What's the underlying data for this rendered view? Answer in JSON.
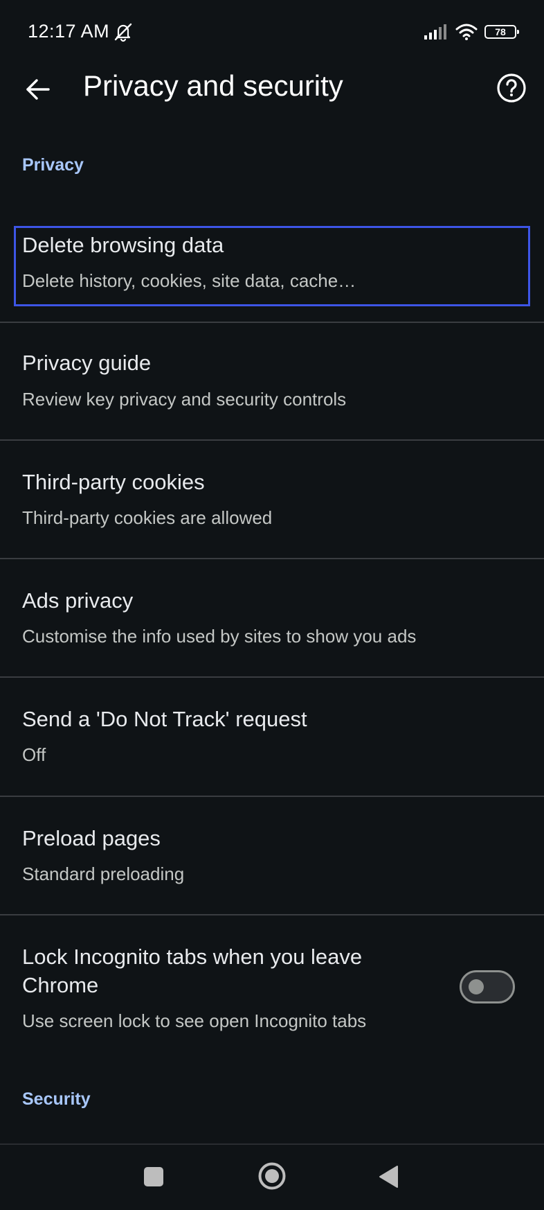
{
  "status_bar": {
    "time": "12:17 AM",
    "battery_level": "78",
    "icons": [
      "mute-icon",
      "signal-icon",
      "wifi-icon",
      "battery-icon"
    ]
  },
  "app_bar": {
    "title": "Privacy and security",
    "back_icon": "arrow-back-icon",
    "help_icon": "help-circle-icon"
  },
  "sections": {
    "privacy_header": "Privacy",
    "security_header": "Security"
  },
  "settings": [
    {
      "title": "Delete browsing data",
      "subtitle": "Delete history, cookies, site data, cache…"
    },
    {
      "title": "Privacy guide",
      "subtitle": "Review key privacy and security controls"
    },
    {
      "title": "Third-party cookies",
      "subtitle": "Third-party cookies are allowed"
    },
    {
      "title": "Ads privacy",
      "subtitle": "Customise the info used by sites to show you ads"
    },
    {
      "title": "Send a 'Do Not Track' request",
      "subtitle": "Off"
    },
    {
      "title": "Preload pages",
      "subtitle": "Standard preloading"
    },
    {
      "title_line1": "Lock Incognito tabs when you leave",
      "title_line2": "Chrome",
      "subtitle": "Use screen lock to see open Incognito tabs",
      "toggle_on": false
    }
  ],
  "nav_bar": {
    "icons": [
      "recents-square-icon",
      "home-circle-icon",
      "back-triangle-icon"
    ]
  },
  "colors": {
    "background": "#0f1316",
    "section_header": "#a8c7fa",
    "focus_outline": "#3d55e6",
    "divider": "#3a3d41"
  }
}
